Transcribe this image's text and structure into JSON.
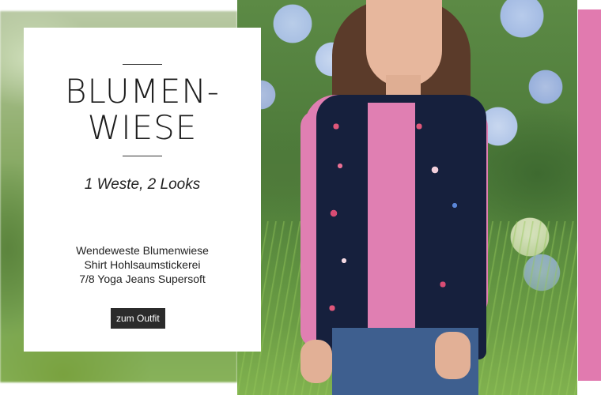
{
  "banner": {
    "headline_line1": "BLUMEN-",
    "headline_line2": "WIESE",
    "subline": "1 Weste, 2 Looks",
    "products": [
      "Wendeweste Blumenwiese",
      "Shirt Hohlsaumstickerei",
      "7/8 Yoga Jeans Supersoft"
    ],
    "cta_label": "zum Outfit",
    "colors": {
      "accent_pink": "#e17aaf",
      "cta_background": "#2b2b2b"
    }
  }
}
